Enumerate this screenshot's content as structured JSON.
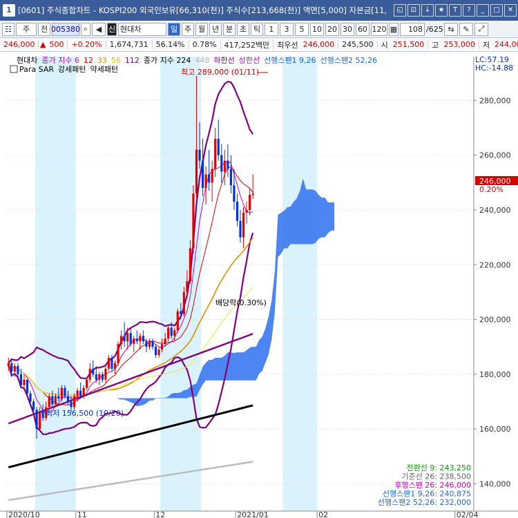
{
  "window": {
    "icon_label": "1",
    "title": "[0601] 주식종합차트 - KOSPI200 외국인보유[66,310(천)] 주식수[213,668(천)] 액면[5,000] 자본금[11,",
    "buttons": [
      "◱",
      "⊡",
      "↓",
      "★",
      "T",
      "?",
      "_",
      "□",
      "✕"
    ]
  },
  "toolbar": {
    "market": "주",
    "type": "전",
    "code": "005380",
    "name_flag": "신",
    "name": "현대차",
    "periods": [
      "일",
      "주",
      "월",
      "년",
      "분",
      "초",
      "틱"
    ],
    "active_period": "일",
    "intervals": [
      "1",
      "3",
      "5",
      "10",
      "20",
      "30",
      "60",
      "120"
    ],
    "count": "108",
    "total": "/625"
  },
  "quote": {
    "price": "246,000",
    "arrow": "▲",
    "change": "500",
    "change_pct": "+0.20%",
    "volume": "1,674,731",
    "vol_ratio": "56.14%",
    "turnover": "0.78%",
    "amount": "417,252백만",
    "pref_label": "최우선",
    "best_ask": "246,000",
    "best_bid": "245,500",
    "open_label": "시",
    "open": "251,500",
    "high_label": "고",
    "high": "253,000",
    "low_label": "저",
    "low": "244,00"
  },
  "legend": {
    "line1": [
      {
        "text": "현대차",
        "color": "#000000"
      },
      {
        "text": "종가 지수 6",
        "color": "#c800c8"
      },
      {
        "text": "12",
        "color": "#d20000"
      },
      {
        "text": "33",
        "color": "#c89600"
      },
      {
        "text": "56",
        "color": "#c8c800"
      },
      {
        "text": "112",
        "color": "#800080"
      },
      {
        "text": "종가 지수 224",
        "color": "#000000"
      },
      {
        "text": "448",
        "color": "#b4b4b4"
      },
      {
        "text": "하한선",
        "color": "#800080"
      },
      {
        "text": "상한선",
        "color": "#c800c8"
      },
      {
        "text": "선행스팬1 9,26",
        "color": "#1e64dc"
      },
      {
        "text": "선행스팬2 52,26",
        "color": "#1e64dc"
      }
    ],
    "line2": [
      {
        "text": "Para SAR",
        "color": "#000000"
      },
      {
        "text": "강세패턴",
        "color": "#000000"
      },
      {
        "text": "약세패턴",
        "color": "#000000"
      }
    ]
  },
  "indicators_right": {
    "lc": "LC:57.19",
    "hc": "HC:-14.88",
    "price_tag": "246,000",
    "price_tag_pct": "0.20%"
  },
  "annotations": {
    "high": "최고 289,000 (01/11)",
    "low": "최저 156,500 (10/20)",
    "dividend": "배당락(0.30%)"
  },
  "ichimoku_values": [
    {
      "text": "전환선 9: 243,250",
      "color": "#00a000"
    },
    {
      "text": "기준선 26: 238,500",
      "color": "#646464"
    },
    {
      "text": "후행스팬 26: 246,000",
      "color": "#c800c8"
    },
    {
      "text": "선행스팬1 9,26: 240,875",
      "color": "#1e64dc"
    },
    {
      "text": "선행스팬2 52,26: 232,000",
      "color": "#1e64dc"
    }
  ],
  "chart_data": {
    "type": "line",
    "ylim": [
      130000,
      296000
    ],
    "y_ticks": [
      140000,
      160000,
      180000,
      200000,
      220000,
      240000,
      260000,
      280000
    ],
    "y_tick_labels": [
      "140,000",
      "160,000",
      "180,000",
      "200,000",
      "220,000",
      "240,000",
      "260,000",
      "280,000"
    ],
    "x_labels": [
      {
        "label": "2020/10",
        "index": 0
      },
      {
        "label": "11",
        "index": 22
      },
      {
        "label": "12",
        "index": 47
      },
      {
        "label": "2021/01",
        "index": 73
      },
      {
        "label": "02",
        "index": 99
      },
      {
        "label": "02/04",
        "index": 143
      }
    ],
    "n_slots": 149,
    "candles": [
      [
        183000,
        186000,
        181000,
        184000
      ],
      [
        184000,
        185000,
        179000,
        181000
      ],
      [
        181000,
        184000,
        179000,
        183000
      ],
      [
        183000,
        184000,
        178000,
        180000
      ],
      [
        180000,
        182000,
        175000,
        176000
      ],
      [
        176000,
        180000,
        174000,
        178000
      ],
      [
        178000,
        178000,
        172000,
        173000
      ],
      [
        173000,
        174000,
        168000,
        170000
      ],
      [
        170000,
        171000,
        166000,
        167000
      ],
      [
        167000,
        168000,
        156500,
        160000
      ],
      [
        160000,
        168000,
        159000,
        166000
      ],
      [
        166000,
        169000,
        163000,
        164000
      ],
      [
        164000,
        170000,
        163000,
        168000
      ],
      [
        168000,
        173000,
        167000,
        172000
      ],
      [
        172000,
        174000,
        168000,
        169000
      ],
      [
        169000,
        173000,
        168000,
        172000
      ],
      [
        172000,
        175000,
        170000,
        171000
      ],
      [
        171000,
        176000,
        170000,
        175000
      ],
      [
        175000,
        176000,
        171000,
        172000
      ],
      [
        172000,
        174000,
        169000,
        170000
      ],
      [
        170000,
        172000,
        166000,
        168000
      ],
      [
        168000,
        173000,
        167000,
        172000
      ],
      [
        172000,
        175000,
        170000,
        174000
      ],
      [
        174000,
        177000,
        171000,
        172000
      ],
      [
        172000,
        176000,
        171000,
        175000
      ],
      [
        175000,
        179000,
        174000,
        178000
      ],
      [
        178000,
        184000,
        177000,
        182000
      ],
      [
        182000,
        185000,
        179000,
        180000
      ],
      [
        180000,
        183000,
        177000,
        178000
      ],
      [
        178000,
        181000,
        176000,
        180000
      ],
      [
        180000,
        181000,
        177000,
        178000
      ],
      [
        178000,
        183000,
        177000,
        182000
      ],
      [
        182000,
        187000,
        181000,
        186000
      ],
      [
        186000,
        187000,
        181000,
        182000
      ],
      [
        182000,
        185000,
        180000,
        184000
      ],
      [
        184000,
        192000,
        183000,
        191000
      ],
      [
        191000,
        196000,
        189000,
        194000
      ],
      [
        194000,
        199000,
        190000,
        192000
      ],
      [
        192000,
        197000,
        189000,
        195000
      ],
      [
        195000,
        197000,
        190000,
        191000
      ],
      [
        191000,
        194000,
        188000,
        193000
      ],
      [
        193000,
        196000,
        191000,
        192000
      ],
      [
        192000,
        195000,
        189000,
        194000
      ],
      [
        194000,
        196000,
        191000,
        192000
      ],
      [
        192000,
        193000,
        188000,
        190000
      ],
      [
        190000,
        193000,
        189000,
        192000
      ],
      [
        192000,
        193000,
        189000,
        190000
      ],
      [
        190000,
        191000,
        186000,
        187000
      ],
      [
        187000,
        190000,
        186000,
        189000
      ],
      [
        189000,
        193000,
        188000,
        191000
      ],
      [
        191000,
        195000,
        190000,
        193000
      ],
      [
        193000,
        198000,
        192000,
        197000
      ],
      [
        197000,
        199000,
        193000,
        194000
      ],
      [
        194000,
        197000,
        192000,
        196000
      ],
      [
        196000,
        204000,
        195000,
        203000
      ],
      [
        203000,
        206000,
        200000,
        202000
      ],
      [
        202000,
        212000,
        201000,
        210000
      ],
      [
        210000,
        218000,
        208000,
        214000
      ],
      [
        214000,
        229000,
        213000,
        226000
      ],
      [
        226000,
        249000,
        224000,
        246000
      ],
      [
        246000,
        289000,
        244000,
        262000
      ],
      [
        262000,
        272000,
        255000,
        258000
      ],
      [
        258000,
        266000,
        245000,
        248000
      ],
      [
        248000,
        256000,
        242000,
        253000
      ],
      [
        253000,
        262000,
        247000,
        250000
      ],
      [
        250000,
        258000,
        243000,
        255000
      ],
      [
        255000,
        270000,
        252000,
        266000
      ],
      [
        266000,
        273000,
        258000,
        260000
      ],
      [
        260000,
        264000,
        250000,
        254000
      ],
      [
        254000,
        262000,
        249000,
        258000
      ],
      [
        258000,
        264000,
        252000,
        255000
      ],
      [
        255000,
        260000,
        246000,
        249000
      ],
      [
        249000,
        255000,
        240000,
        243000
      ],
      [
        243000,
        246000,
        234000,
        236000
      ],
      [
        236000,
        240000,
        228000,
        230000
      ],
      [
        230000,
        241000,
        226000,
        239000
      ],
      [
        239000,
        243000,
        235000,
        240000
      ],
      [
        240000,
        248000,
        238000,
        245500
      ],
      [
        245500,
        253000,
        244000,
        246000
      ]
    ]
  }
}
